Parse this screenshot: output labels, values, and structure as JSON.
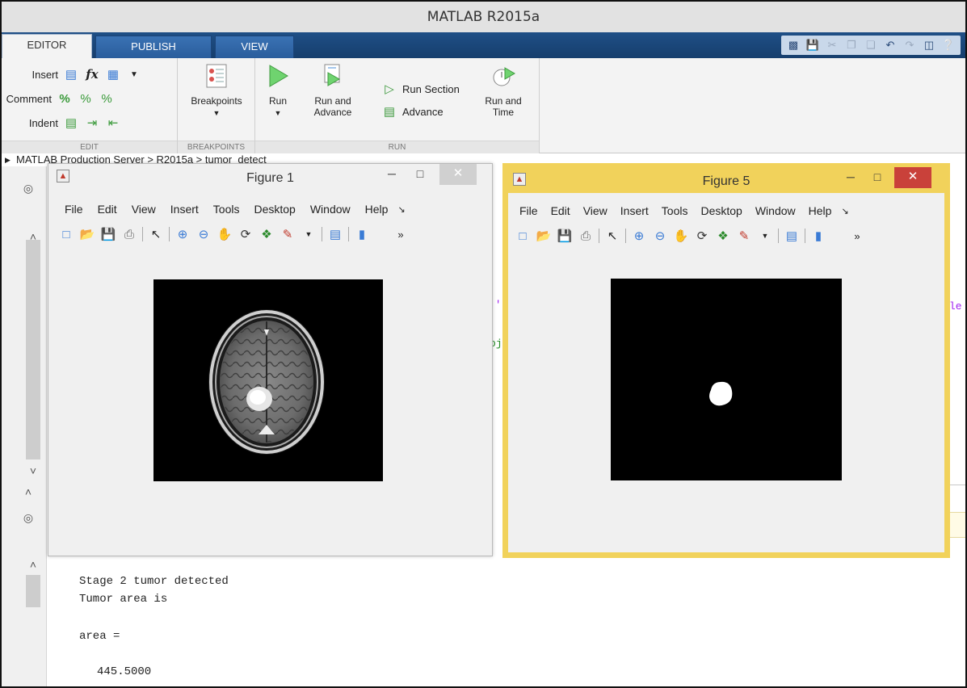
{
  "app": {
    "title": "MATLAB R2015a"
  },
  "tabs": [
    {
      "label": "EDITOR"
    },
    {
      "label": "PUBLISH"
    },
    {
      "label": "VIEW"
    }
  ],
  "ribbon": {
    "edit": {
      "insert": "Insert",
      "fx": "fx",
      "comment": "Comment",
      "indent": "Indent",
      "group": "EDIT"
    },
    "breakpoints": {
      "label": "Breakpoints",
      "group": "BREAKPOINTS"
    },
    "run": {
      "run": "Run",
      "run_and_advance_1": "Run and",
      "run_and_advance_2": "Advance",
      "run_section": "Run Section",
      "advance": "Advance",
      "run_and_time_1": "Run and",
      "run_and_time_2": "Time",
      "group": "RUN"
    }
  },
  "pathbar": {
    "text": "MATLAB Production Server > R2015a > tumor_detect"
  },
  "peek": {
    "frag1": "·'",
    "frag2": "oj",
    "frag3": "le"
  },
  "figure1": {
    "title": "Figure 1",
    "menu": [
      "File",
      "Edit",
      "View",
      "Insert",
      "Tools",
      "Desktop",
      "Window",
      "Help"
    ]
  },
  "figure5": {
    "title": "Figure 5",
    "menu": [
      "File",
      "Edit",
      "View",
      "Insert",
      "Tools",
      "Desktop",
      "Window",
      "Help"
    ]
  },
  "command_window": {
    "line1": "Stage 2 tumor detected",
    "line2": "Tumor area is",
    "line3": "area =",
    "line4": "445.5000"
  },
  "colors": {
    "tab_bar": "#1f4f86",
    "focus_border": "#f1d25b",
    "close_red": "#c9413a"
  },
  "icons": {
    "run": "play-icon",
    "run_and_time": "stopwatch-icon",
    "breakpoints": "breakpoints-icon"
  }
}
